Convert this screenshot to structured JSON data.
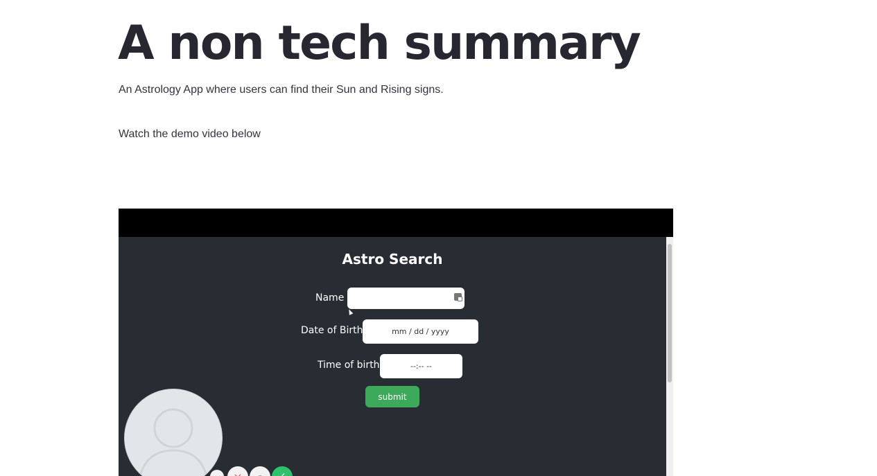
{
  "page": {
    "title": "A non tech summary",
    "description": "An Astrology App where users can find their Sun and Rising signs.",
    "demo_text": "Watch the demo video below"
  },
  "video": {
    "app_title": "Astro Search",
    "form": {
      "name_label": "Name",
      "name_value": "",
      "dob_label": "Date of Birth",
      "dob_placeholder": "mm / dd / yyyy",
      "time_label": "Time of birth",
      "time_placeholder": "--:-- --",
      "submit_label": "submit"
    },
    "recorder_controls": {
      "more_label": "...",
      "cancel_label": "×",
      "pause_label": "⏸",
      "done_label": "✓"
    },
    "colors": {
      "screen_bg": "#282c33",
      "submit_bg": "#3caa5a",
      "done_bg": "#2fc26b"
    }
  }
}
